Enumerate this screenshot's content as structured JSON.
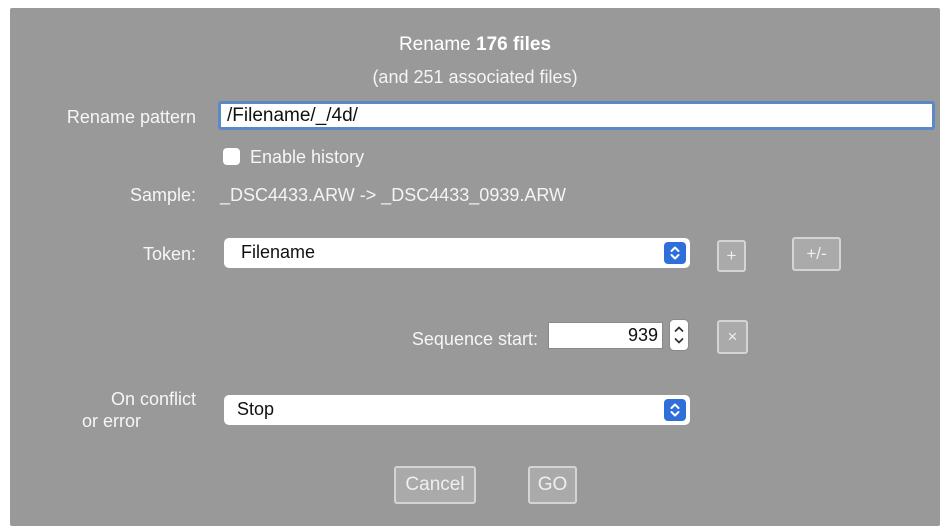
{
  "dialog": {
    "title_prefix": "Rename ",
    "title_bold": "176 files",
    "subtitle": "(and 251 associated files)"
  },
  "rename_pattern": {
    "label": "Rename pattern",
    "value": "/Filename/_/4d/"
  },
  "history": {
    "label": "Enable history",
    "checked": false
  },
  "sample": {
    "label": "Sample:",
    "value": "_DSC4433.ARW -> _DSC4433_0939.ARW"
  },
  "token": {
    "label": "Token:",
    "selected": "Filename",
    "add_button": "+",
    "toggle_button": "+/-"
  },
  "sequence": {
    "label": "Sequence start:",
    "value": "939",
    "clear_button": "×"
  },
  "conflict": {
    "label_line1": "On conflict",
    "label_line2": "or error",
    "selected": "Stop"
  },
  "actions": {
    "cancel": "Cancel",
    "go": "GO"
  },
  "icons": {
    "select_arrows": "chevron-up-down-icon",
    "stepper": "stepper-icon"
  },
  "colors": {
    "dialog_bg": "#999999",
    "accent": "#2f6fd9",
    "focus_ring": "#5a89c6"
  }
}
